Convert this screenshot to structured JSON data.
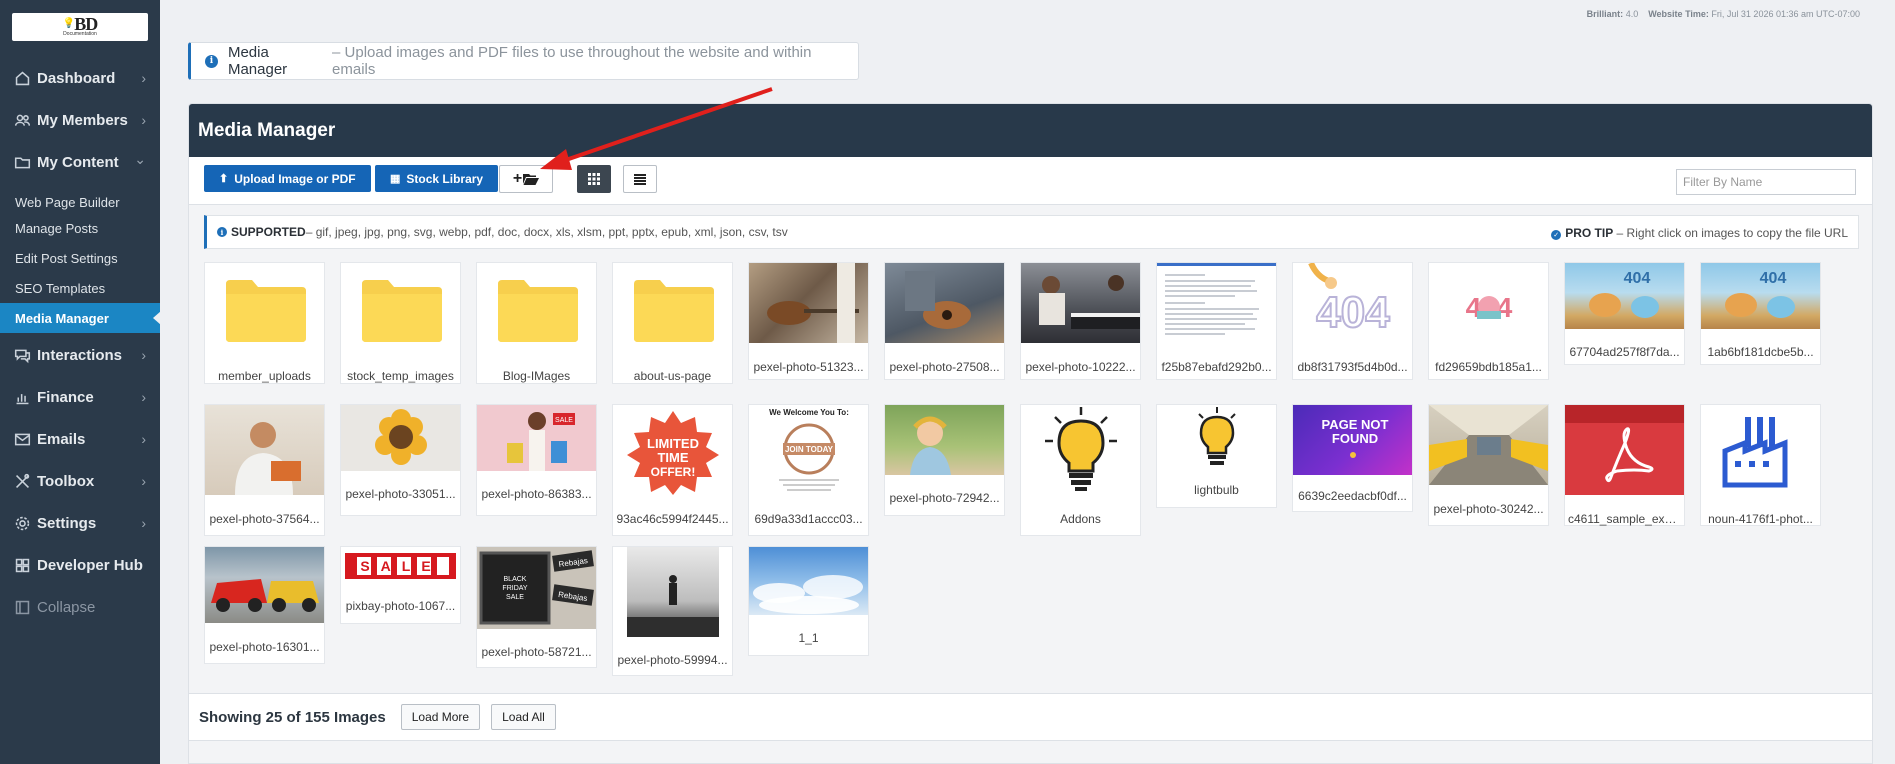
{
  "logo": {
    "main": "BD",
    "sub": "Documentation"
  },
  "sidebar": {
    "items": [
      {
        "label": "Dashboard",
        "icon": "home-icon",
        "chevron": "›"
      },
      {
        "label": "My Members",
        "icon": "users-icon",
        "chevron": "›"
      },
      {
        "label": "My Content",
        "icon": "folder-icon",
        "chevron": "⌄"
      },
      {
        "label": "Interactions",
        "icon": "chat-icon",
        "chevron": "›"
      },
      {
        "label": "Finance",
        "icon": "chart-icon",
        "chevron": "›"
      },
      {
        "label": "Emails",
        "icon": "mail-icon",
        "chevron": "›"
      },
      {
        "label": "Toolbox",
        "icon": "tools-icon",
        "chevron": "›"
      },
      {
        "label": "Settings",
        "icon": "gear-icon",
        "chevron": "›"
      },
      {
        "label": "Developer Hub",
        "icon": "grid-icon",
        "chevron": ""
      },
      {
        "label": "Collapse",
        "icon": "collapse-icon",
        "chevron": ""
      }
    ],
    "subitems": [
      "Web Page Builder",
      "Manage Posts",
      "Edit Post Settings",
      "SEO Templates",
      "Media Manager"
    ]
  },
  "topinfo": {
    "version_label": "Brilliant:",
    "version": "4.0",
    "time_label": "Website Time:",
    "time": "Fri, Jul 31 2026 01:36 am UTC-07:00"
  },
  "alert": {
    "title": "Media Manager",
    "text": " – Upload images and PDF files to use throughout the website and within emails"
  },
  "panel": {
    "title": "Media Manager"
  },
  "toolbar": {
    "upload_label": "Upload Image or PDF",
    "stock_label": "Stock Library",
    "new_folder_label": "+",
    "filter_placeholder": "Filter By Name"
  },
  "supported": {
    "label": "SUPPORTED",
    "formats": " – gif, jpeg, jpg, png, svg, webp, pdf, doc, docx, xls, xlsm, ppt, pptx, epub, xml, json, csv, tsv",
    "tip_label": "PRO TIP",
    "tip_text": " – Right click on images to copy the file URL"
  },
  "media": [
    {
      "name": "member_uploads",
      "kind": "folder"
    },
    {
      "name": "stock_temp_images",
      "kind": "folder"
    },
    {
      "name": "Blog-IMages",
      "kind": "folder"
    },
    {
      "name": "about-us-page",
      "kind": "folder"
    },
    {
      "name": "pexel-photo-51323...",
      "kind": "photo",
      "color": "#8a7a6a"
    },
    {
      "name": "pexel-photo-27508...",
      "kind": "photo",
      "color": "#6a7584"
    },
    {
      "name": "pexel-photo-10222...",
      "kind": "photo",
      "color": "#5c5f66"
    },
    {
      "name": "f25b87ebafd292b0...",
      "kind": "document"
    },
    {
      "name": "db8f31793f5d4b0d...",
      "kind": "404-a"
    },
    {
      "name": "fd29659bdb185a1...",
      "kind": "404-b"
    },
    {
      "name": "67704ad257f8f7da...",
      "kind": "404-c"
    },
    {
      "name": "1ab6bf181dcbe5b...",
      "kind": "404-c"
    },
    {
      "name": "pexel-photo-37564...",
      "kind": "photo",
      "color": "#c9a889"
    },
    {
      "name": "pexel-photo-33051...",
      "kind": "sunflower"
    },
    {
      "name": "pexel-photo-86383...",
      "kind": "shopping"
    },
    {
      "name": "93ac46c5994f2445...",
      "kind": "limited",
      "text": "LIMITED TIME OFFER!"
    },
    {
      "name": "69d9a33d1accc03...",
      "kind": "welcome",
      "text": "We Welcome You To:",
      "stamp": "JOIN TODAY"
    },
    {
      "name": "pexel-photo-72942...",
      "kind": "photo",
      "color": "#8aa36a"
    },
    {
      "name": "Addons",
      "kind": "bulb-big"
    },
    {
      "name": "lightbulb",
      "kind": "bulb-small"
    },
    {
      "name": "6639c2eedacbf0df...",
      "kind": "pagenotfound",
      "text": "PAGE NOT FOUND"
    },
    {
      "name": "pexel-photo-30242...",
      "kind": "train"
    },
    {
      "name": "c4611_sample_expl...",
      "kind": "pdf"
    },
    {
      "name": "noun-4176f1-phot...",
      "kind": "factory"
    },
    {
      "name": "pexel-photo-16301...",
      "kind": "crash"
    },
    {
      "name": "pixbay-photo-1067...",
      "kind": "sale",
      "text": "SALE"
    },
    {
      "name": "pexel-photo-58721...",
      "kind": "blackfriday",
      "text": "BLACK FRIDAY SALE",
      "tags": [
        "Rebajas",
        "Rebajas"
      ]
    },
    {
      "name": "pexel-photo-59994...",
      "kind": "man"
    },
    {
      "name": "1_1",
      "kind": "sky"
    }
  ],
  "footer": {
    "showing": "Showing 25 of 155 Images",
    "load_more": "Load More",
    "load_all": "Load All"
  }
}
